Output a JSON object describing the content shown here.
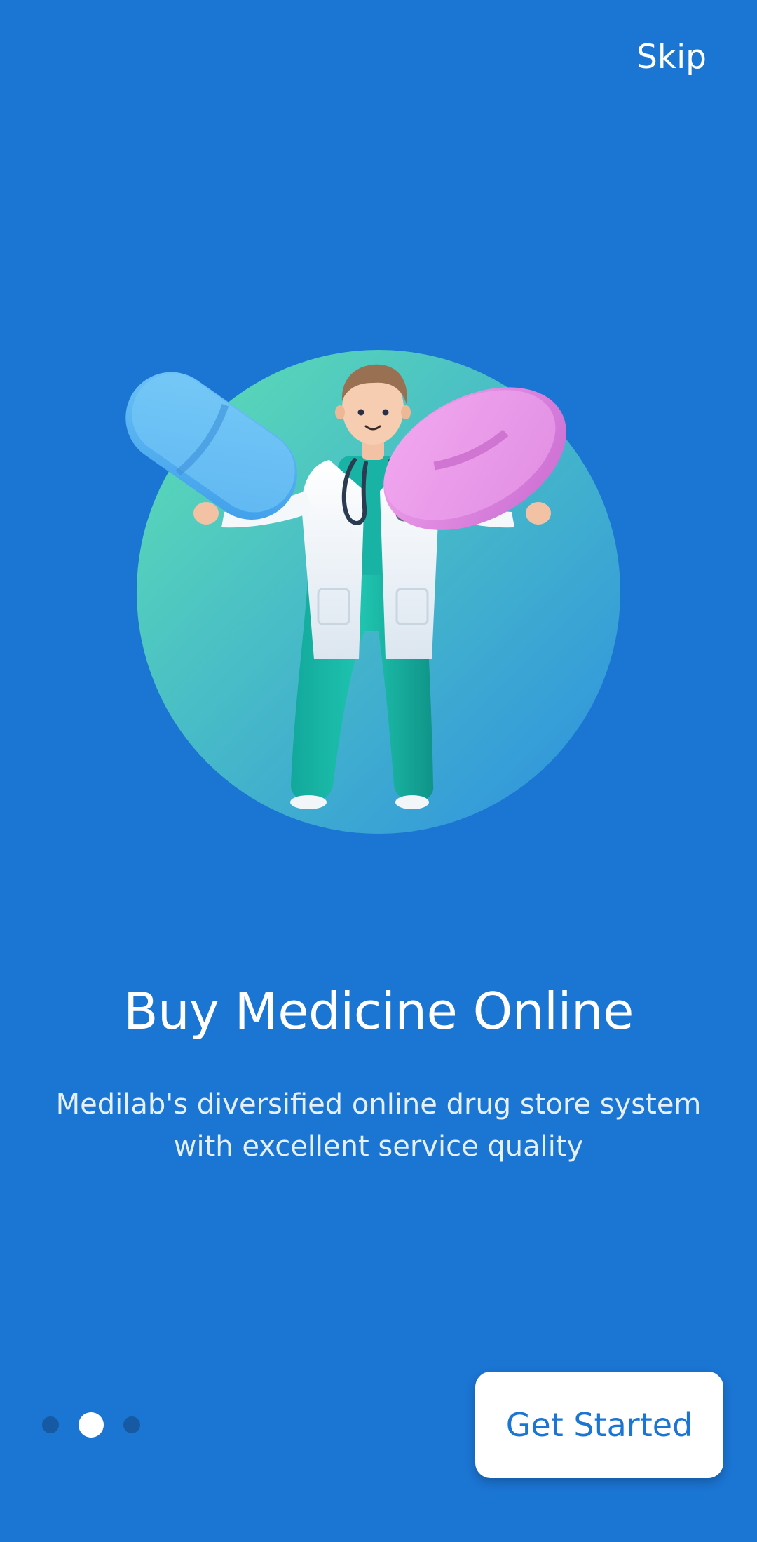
{
  "header": {
    "skip_label": "Skip"
  },
  "onboarding": {
    "illustration_icon": "doctor-holding-pills-illustration",
    "title": "Buy Medicine Online",
    "description": "Medilab's diversified online drug store system with excellent service quality",
    "pager": {
      "total_pages": 3,
      "current_page": 2
    },
    "cta_label": "Get Started"
  },
  "colors": {
    "background": "#1B75D3",
    "cta_text": "#1B75D3",
    "cta_background": "#FFFFFF",
    "dot_inactive": "#155AA3",
    "dot_active": "#FFFFFF",
    "circle_gradient_start": "#5EE0B3",
    "circle_gradient_end": "#2D9BDF",
    "pill_blue": "#5EB5F3",
    "pill_pink": "#E38AE0"
  }
}
